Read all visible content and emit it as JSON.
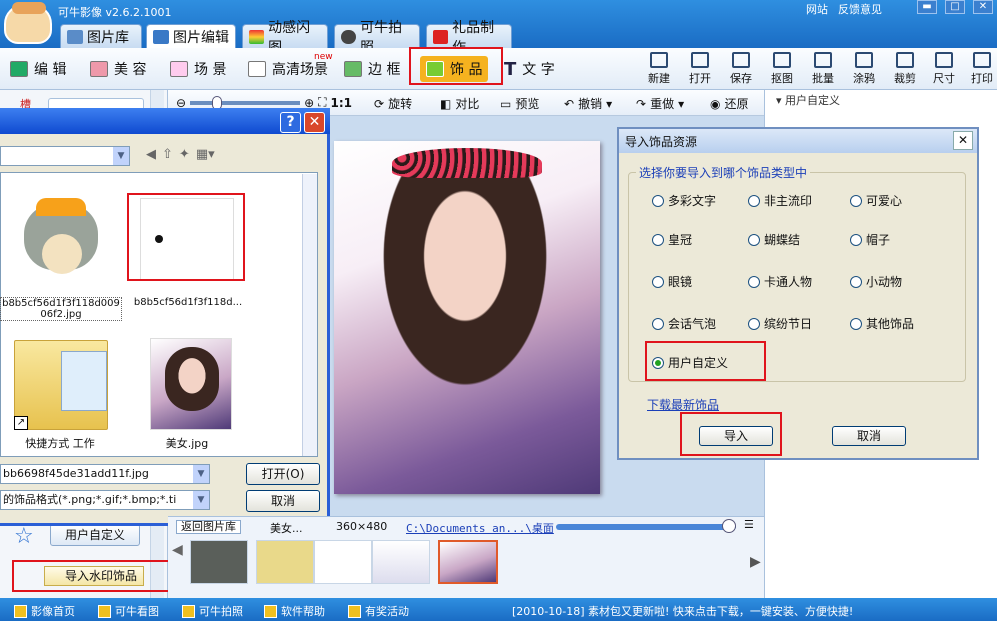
{
  "app": {
    "title": "可牛影像 v2.6.2.1001",
    "links": [
      "网站",
      "反馈意见"
    ],
    "window_buttons": [
      "▬",
      "□",
      "✕"
    ]
  },
  "main_tabs": [
    "图片库",
    "图片编辑",
    "动感闪图",
    "可牛拍照",
    "礼品制作"
  ],
  "edit_tabs": [
    "编 辑",
    "美 容",
    "场 景",
    "高清场景",
    "边 框",
    "饰 品",
    "文 字"
  ],
  "new_badge": "new",
  "right_tools": [
    "新建",
    "打开",
    "保存",
    "抠图",
    "批量",
    "涂鸦",
    "裁剪",
    "尺寸",
    "打印"
  ],
  "canvas_tools": {
    "zoom_ratio": "1:1",
    "rotate": "旋转",
    "contrast": "对比",
    "preview": "预览",
    "undo": "撤销",
    "redo": "重做",
    "restore": "还原"
  },
  "right_panel": {
    "title": "用户自定义"
  },
  "left_panel": {
    "custom_btn": "用户自定义",
    "import_watermark": "导入水印饰品",
    "header_glyph": "槽"
  },
  "file_dialog": {
    "help": "?",
    "close": "✕",
    "files": [
      {
        "name": "b8b5cf56d1f3f118d00906f2.jpg",
        "type": "cartoon"
      },
      {
        "name": "b8b5cf56d1f3f118d...",
        "type": "blank"
      },
      {
        "name": "快捷方式 工作",
        "type": "folder"
      },
      {
        "name": "美女.jpg",
        "type": "photo"
      }
    ],
    "filename": "bb6698f45de31add11f.jpg",
    "filetype": "的饰品格式(*.png;*.gif;*.bmp;*.ti",
    "open_btn": "打开(O)",
    "cancel_btn": "取消"
  },
  "import_dialog": {
    "title": "导入饰品资源",
    "close": "✕",
    "group_label": "选择你要导入到哪个饰品类型中",
    "options": [
      [
        "多彩文字",
        "非主流印",
        "可爱心"
      ],
      [
        "皇冠",
        "蝴蝶结",
        "帽子"
      ],
      [
        "眼镜",
        "卡通人物",
        "小动物"
      ],
      [
        "会话气泡",
        "缤纷节日",
        "其他饰品"
      ]
    ],
    "selected": "用户自定义",
    "download_link": "下载最新饰品",
    "import_btn": "导入",
    "cancel_btn": "取消"
  },
  "filmstrip": {
    "back_btn": "返回图片库",
    "current_name": "美女...",
    "dimensions": "360×480",
    "path": "C:\\Documents an...\\桌面"
  },
  "status_bar": {
    "items": [
      "影像首页",
      "可牛看图",
      "可牛拍照",
      "软件帮助",
      "有奖活动"
    ],
    "news": "[2010-10-18] 素材包又更新啦! 快来点击下载，一键安装、方便快捷!"
  },
  "colors": {
    "brand_blue": "#1a6cc4",
    "highlight_red": "#e0141c",
    "link_blue": "#1b3fb8"
  }
}
